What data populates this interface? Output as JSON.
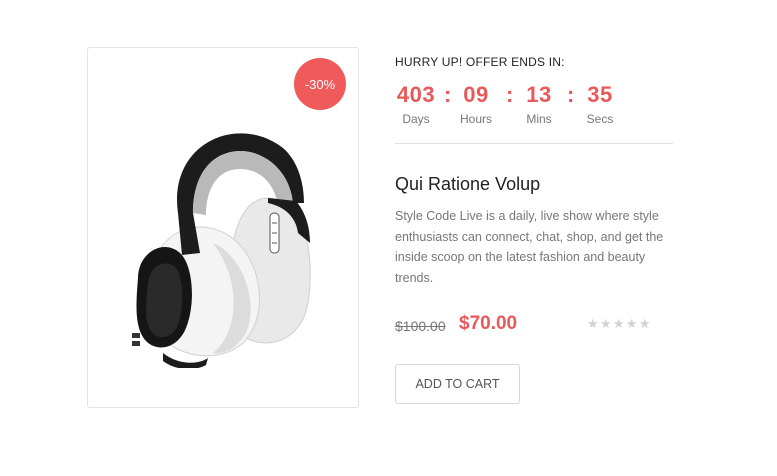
{
  "product_card": {
    "discount_badge": "-30%",
    "image_icon": "headphones-icon"
  },
  "countdown": {
    "label": "HURRY UP! OFFER ENDS IN:",
    "separator": ":",
    "days": {
      "value": "403",
      "label": "Days"
    },
    "hours": {
      "value": "09",
      "label": "Hours"
    },
    "mins": {
      "value": "13",
      "label": "Mins"
    },
    "secs": {
      "value": "35",
      "label": "Secs"
    }
  },
  "product": {
    "title": "Qui Ratione Volup",
    "description": "Style Code Live is a daily, live show where style enthusiasts can connect, chat, shop, and get the inside scoop on the latest fashion and beauty trends.",
    "old_price": "$100.00",
    "new_price": "$70.00",
    "rating": {
      "value": 0,
      "max": 5,
      "star_glyph": "★"
    },
    "add_to_cart_label": "ADD TO CART"
  },
  "colors": {
    "accent": "#e8595a",
    "badge": "#f05a5a",
    "star_empty": "#d2d2d2"
  }
}
